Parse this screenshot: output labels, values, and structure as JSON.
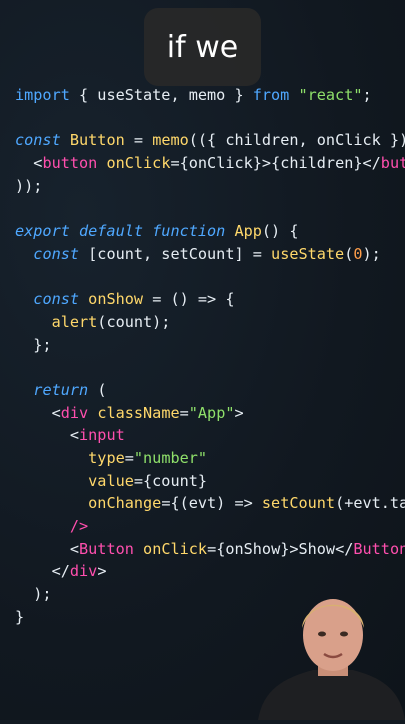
{
  "caption": "if we",
  "code_lines": [
    [
      {
        "c": "kw-plain",
        "t": "import"
      },
      {
        "c": "",
        "t": " { useState, memo } "
      },
      {
        "c": "kw-plain",
        "t": "from"
      },
      {
        "c": "",
        "t": " "
      },
      {
        "c": "str",
        "t": "\"react\""
      },
      {
        "c": "",
        "t": ";"
      }
    ],
    [],
    [
      {
        "c": "kw",
        "t": "const"
      },
      {
        "c": "",
        "t": " "
      },
      {
        "c": "fn",
        "t": "Button"
      },
      {
        "c": "",
        "t": " = "
      },
      {
        "c": "fn",
        "t": "memo"
      },
      {
        "c": "",
        "t": "(({ children, onClick })"
      }
    ],
    [
      {
        "c": "",
        "t": "  <"
      },
      {
        "c": "tag",
        "t": "button"
      },
      {
        "c": "",
        "t": " "
      },
      {
        "c": "attr",
        "t": "onClick"
      },
      {
        "c": "",
        "t": "={onClick}>{children}</"
      },
      {
        "c": "tag",
        "t": "button"
      },
      {
        "c": "",
        "t": ">"
      }
    ],
    [
      {
        "c": "",
        "t": "));"
      }
    ],
    [],
    [
      {
        "c": "kw",
        "t": "export default function"
      },
      {
        "c": "",
        "t": " "
      },
      {
        "c": "fn",
        "t": "App"
      },
      {
        "c": "",
        "t": "() {"
      }
    ],
    [
      {
        "c": "",
        "t": "  "
      },
      {
        "c": "kw",
        "t": "const"
      },
      {
        "c": "",
        "t": " [count, setCount] = "
      },
      {
        "c": "fn",
        "t": "useState"
      },
      {
        "c": "",
        "t": "("
      },
      {
        "c": "num",
        "t": "0"
      },
      {
        "c": "",
        "t": ");"
      }
    ],
    [],
    [
      {
        "c": "",
        "t": "  "
      },
      {
        "c": "kw",
        "t": "const"
      },
      {
        "c": "",
        "t": " "
      },
      {
        "c": "fn",
        "t": "onShow"
      },
      {
        "c": "",
        "t": " = () => {"
      }
    ],
    [
      {
        "c": "",
        "t": "    "
      },
      {
        "c": "fn",
        "t": "alert"
      },
      {
        "c": "",
        "t": "(count);"
      }
    ],
    [
      {
        "c": "",
        "t": "  };"
      }
    ],
    [],
    [
      {
        "c": "",
        "t": "  "
      },
      {
        "c": "kw",
        "t": "return"
      },
      {
        "c": "",
        "t": " ("
      }
    ],
    [
      {
        "c": "",
        "t": "    <"
      },
      {
        "c": "tag",
        "t": "div"
      },
      {
        "c": "",
        "t": " "
      },
      {
        "c": "attr",
        "t": "className"
      },
      {
        "c": "",
        "t": "="
      },
      {
        "c": "str",
        "t": "\"App\""
      },
      {
        "c": "",
        "t": ">"
      }
    ],
    [
      {
        "c": "",
        "t": "      <"
      },
      {
        "c": "tag",
        "t": "input"
      }
    ],
    [
      {
        "c": "",
        "t": "        "
      },
      {
        "c": "attr",
        "t": "type"
      },
      {
        "c": "",
        "t": "="
      },
      {
        "c": "str",
        "t": "\"number\""
      }
    ],
    [
      {
        "c": "",
        "t": "        "
      },
      {
        "c": "attr",
        "t": "value"
      },
      {
        "c": "",
        "t": "={count}"
      }
    ],
    [
      {
        "c": "",
        "t": "        "
      },
      {
        "c": "attr",
        "t": "onChange"
      },
      {
        "c": "",
        "t": "={(evt) => "
      },
      {
        "c": "fn",
        "t": "setCount"
      },
      {
        "c": "",
        "t": "(+evt.target.value)}"
      }
    ],
    [
      {
        "c": "",
        "t": "      "
      },
      {
        "c": "tag",
        "t": "/>"
      }
    ],
    [
      {
        "c": "",
        "t": "      <"
      },
      {
        "c": "tag",
        "t": "Button"
      },
      {
        "c": "",
        "t": " "
      },
      {
        "c": "attr",
        "t": "onClick"
      },
      {
        "c": "",
        "t": "={onShow}>Show</"
      },
      {
        "c": "tag",
        "t": "Button"
      },
      {
        "c": "",
        "t": ">"
      }
    ],
    [
      {
        "c": "",
        "t": "    </"
      },
      {
        "c": "tag",
        "t": "div"
      },
      {
        "c": "",
        "t": ">"
      }
    ],
    [
      {
        "c": "",
        "t": "  );"
      }
    ],
    [
      {
        "c": "",
        "t": "}"
      }
    ]
  ],
  "colors": {
    "background": "#121a22",
    "keyword": "#4fa8ff",
    "function": "#ffd86b",
    "tag": "#ff4fae",
    "string": "#8fe06a",
    "number": "#ff9e4a",
    "text": "#e6edf3"
  },
  "presenter": {
    "icon": "presenter-webcam-overlay"
  }
}
